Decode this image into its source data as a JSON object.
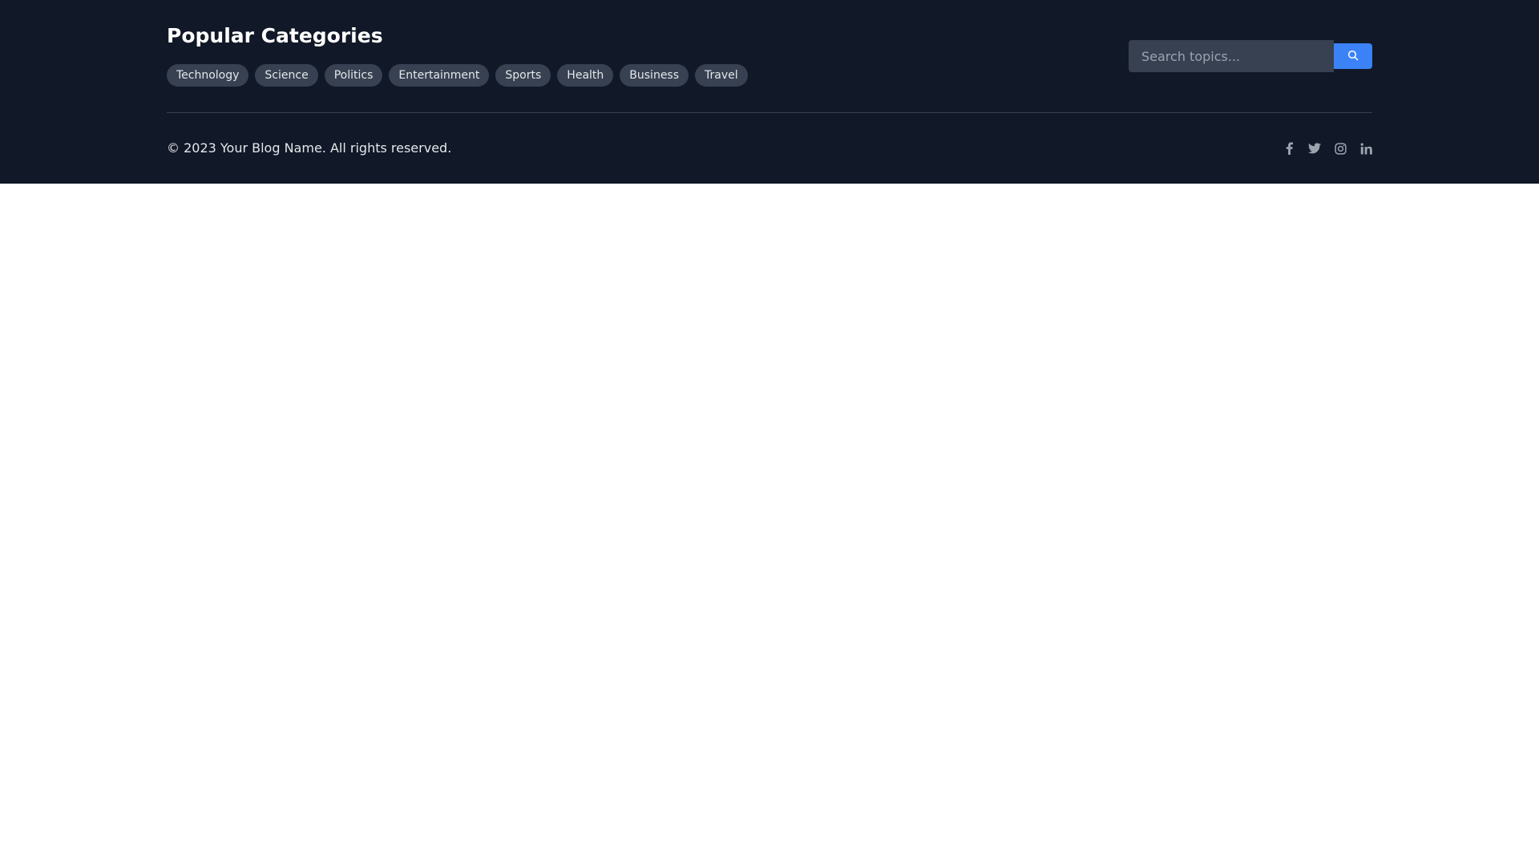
{
  "footer": {
    "title": "Popular Categories",
    "tags": [
      {
        "label": "Technology"
      },
      {
        "label": "Science"
      },
      {
        "label": "Politics"
      },
      {
        "label": "Entertainment"
      },
      {
        "label": "Sports"
      },
      {
        "label": "Health"
      },
      {
        "label": "Business"
      },
      {
        "label": "Travel"
      }
    ],
    "search": {
      "placeholder": "Search topics...",
      "value": "",
      "button_icon": "search-icon"
    },
    "copyright": "© 2023 Your Blog Name. All rights reserved.",
    "socials": [
      {
        "icon": "facebook-icon"
      },
      {
        "icon": "twitter-icon"
      },
      {
        "icon": "instagram-icon"
      },
      {
        "icon": "linkedin-icon"
      }
    ]
  },
  "colors": {
    "background": "#111827",
    "tag_bg": "#374151",
    "accent": "#3b82f6",
    "text": "#e5e7eb",
    "muted": "#9ca3af"
  }
}
